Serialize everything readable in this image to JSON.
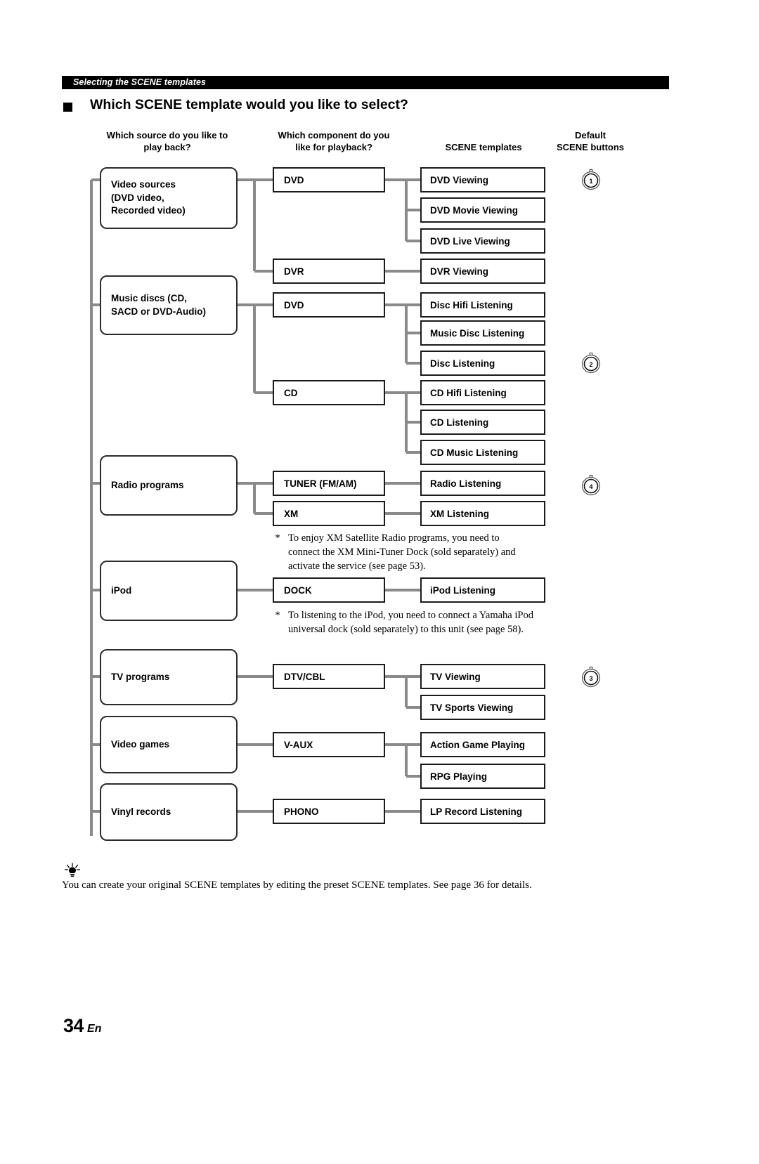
{
  "page": {
    "running_header": "Selecting the SCENE templates",
    "section_title": "Which SCENE template would you like to select?",
    "footer_number": "34",
    "footer_lang": "En"
  },
  "columns": {
    "source": "Which source do you like to\nplay back?",
    "component": "Which component do you\nlike for playback?",
    "templates": "SCENE templates",
    "buttons": "Default\nSCENE buttons"
  },
  "sources": [
    {
      "id": "video-sources",
      "label": "Video sources\n(DVD video,\nRecorded video)"
    },
    {
      "id": "music-discs",
      "label": "Music discs (CD,\nSACD or DVD-Audio)"
    },
    {
      "id": "radio-programs",
      "label": "Radio programs"
    },
    {
      "id": "ipod",
      "label": "iPod"
    },
    {
      "id": "tv-programs",
      "label": "TV programs"
    },
    {
      "id": "video-games",
      "label": "Video games"
    },
    {
      "id": "vinyl-records",
      "label": "Vinyl records"
    }
  ],
  "components": [
    {
      "id": "dvd-1",
      "label": "DVD"
    },
    {
      "id": "dvr",
      "label": "DVR"
    },
    {
      "id": "dvd-2",
      "label": "DVD"
    },
    {
      "id": "cd",
      "label": "CD"
    },
    {
      "id": "tuner",
      "label": "TUNER (FM/AM)"
    },
    {
      "id": "xm",
      "label": "XM"
    },
    {
      "id": "dock",
      "label": "DOCK"
    },
    {
      "id": "dtv-cbl",
      "label": "DTV/CBL"
    },
    {
      "id": "v-aux",
      "label": "V-AUX"
    },
    {
      "id": "phono",
      "label": "PHONO"
    }
  ],
  "templates": [
    {
      "id": "dvd-viewing",
      "label": "DVD Viewing"
    },
    {
      "id": "dvd-movie-viewing",
      "label": "DVD Movie Viewing"
    },
    {
      "id": "dvd-live-viewing",
      "label": "DVD Live Viewing"
    },
    {
      "id": "dvr-viewing",
      "label": "DVR Viewing"
    },
    {
      "id": "disc-hifi",
      "label": "Disc Hifi Listening"
    },
    {
      "id": "music-disc",
      "label": "Music Disc Listening"
    },
    {
      "id": "disc-listening",
      "label": "Disc Listening"
    },
    {
      "id": "cd-hifi",
      "label": "CD Hifi Listening"
    },
    {
      "id": "cd-listening",
      "label": "CD Listening"
    },
    {
      "id": "cd-music",
      "label": "CD Music Listening"
    },
    {
      "id": "radio-listening",
      "label": "Radio Listening"
    },
    {
      "id": "xm-listening",
      "label": "XM Listening"
    },
    {
      "id": "ipod-listening",
      "label": "iPod Listening"
    },
    {
      "id": "tv-viewing",
      "label": "TV Viewing"
    },
    {
      "id": "tv-sports-viewing",
      "label": "TV Sports Viewing"
    },
    {
      "id": "action-game",
      "label": "Action Game Playing"
    },
    {
      "id": "rpg-playing",
      "label": "RPG Playing"
    },
    {
      "id": "lp-record",
      "label": "LP Record Listening"
    }
  ],
  "scene_buttons": [
    {
      "id": "scene-1",
      "number": "1",
      "for": "DVD Viewing"
    },
    {
      "id": "scene-2",
      "number": "2",
      "for": "Disc Listening"
    },
    {
      "id": "scene-4",
      "number": "4",
      "for": "Radio Listening"
    },
    {
      "id": "scene-3",
      "number": "3",
      "for": "TV Viewing"
    }
  ],
  "footnotes": {
    "xm": "To enjoy XM Satellite Radio programs, you need to connect the XM Mini-Tuner Dock (sold separately) and activate the service (see page 53).",
    "ipod": "To listening to the iPod, you need to connect a Yamaha iPod universal dock (sold separately) to this unit (see page 58).",
    "marker": "*"
  },
  "tip": {
    "icon": "tip-bulb-icon",
    "text": "You can create your original SCENE templates by editing the preset SCENE templates. See page 36 for details."
  },
  "colors": {
    "header_bar": "#000000",
    "box_border": "#1a1a1a",
    "connector": "#8a8a8a"
  }
}
